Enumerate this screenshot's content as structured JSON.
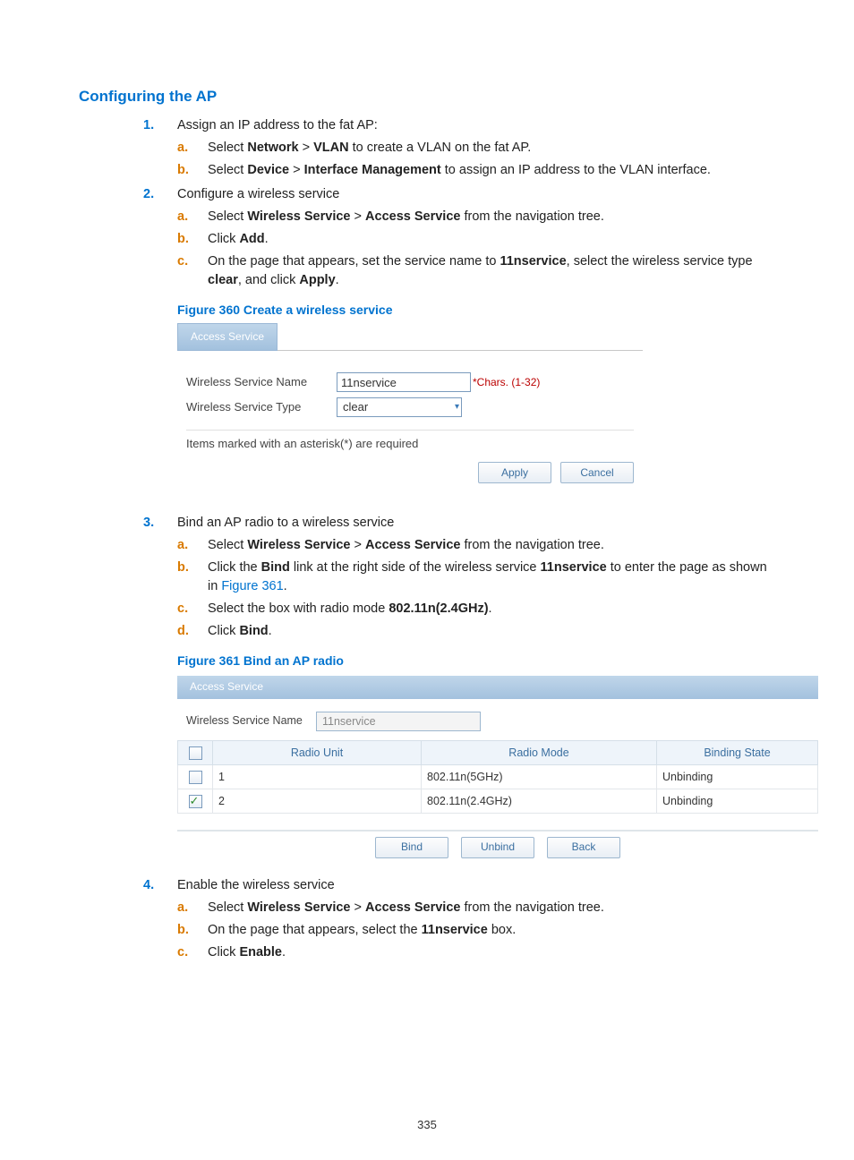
{
  "page_number": "335",
  "section_title": "Configuring the AP",
  "steps": {
    "s1": {
      "marker": "1.",
      "text": "Assign an IP address to the fat AP:",
      "a": {
        "m": "a.",
        "pre": "Select ",
        "b1": "Network",
        "sep": " > ",
        "b2": "VLAN",
        "post": " to create a VLAN on the fat AP."
      },
      "b": {
        "m": "b.",
        "pre": "Select ",
        "b1": "Device",
        "sep": " > ",
        "b2": "Interface Management",
        "post": " to assign an IP address to the VLAN interface."
      }
    },
    "s2": {
      "marker": "2.",
      "text": "Configure a wireless service",
      "a": {
        "m": "a.",
        "pre": "Select ",
        "b1": "Wireless Service",
        "sep": " > ",
        "b2": "Access Service",
        "post": " from the navigation tree."
      },
      "b": {
        "m": "b.",
        "pre": "Click ",
        "b1": "Add",
        "post": "."
      },
      "c": {
        "m": "c.",
        "pre": "On the page that appears, set the service name to ",
        "b1": "11nservice",
        "mid": ", select the wireless service type ",
        "b2": "clear",
        "post": ", and click ",
        "b3": "Apply",
        "post2": "."
      }
    },
    "s3": {
      "marker": "3.",
      "text": "Bind an AP radio to a wireless service",
      "a": {
        "m": "a.",
        "pre": "Select ",
        "b1": "Wireless Service",
        "sep": " > ",
        "b2": "Access Service",
        "post": " from the navigation tree."
      },
      "b": {
        "m": "b.",
        "pre": "Click the ",
        "b1": "Bind",
        "mid": " link at the right side of the wireless service ",
        "b2": "11nservice",
        "post": " to enter the page as shown in ",
        "link": "Figure 361",
        "post2": "."
      },
      "c": {
        "m": "c.",
        "pre": "Select the box with radio mode ",
        "b1": "802.11n(2.4GHz)",
        "post": "."
      },
      "d": {
        "m": "d.",
        "pre": "Click ",
        "b1": "Bind",
        "post": "."
      }
    },
    "s4": {
      "marker": "4.",
      "text": "Enable the wireless service",
      "a": {
        "m": "a.",
        "pre": "Select ",
        "b1": "Wireless Service",
        "sep": " > ",
        "b2": "Access Service",
        "post": " from the navigation tree."
      },
      "b": {
        "m": "b.",
        "pre": "On the page that appears, select the ",
        "b1": "11nservice",
        "post": " box."
      },
      "c": {
        "m": "c.",
        "pre": "Click ",
        "b1": "Enable",
        "post": "."
      }
    }
  },
  "fig360": {
    "caption": "Figure 360 Create a wireless service",
    "tab": "Access Service",
    "name_label": "Wireless Service Name",
    "name_value": "11nservice",
    "name_hint": "*Chars. (1-32)",
    "type_label": "Wireless Service Type",
    "type_value": "clear",
    "note": "Items marked with an asterisk(*) are required",
    "apply": "Apply",
    "cancel": "Cancel"
  },
  "fig361": {
    "caption": "Figure 361 Bind an AP radio",
    "tab": "Access Service",
    "name_label": "Wireless Service Name",
    "name_value": "11nservice",
    "th_ru": "Radio Unit",
    "th_rm": "Radio Mode",
    "th_bs": "Binding State",
    "rows": [
      {
        "checked": false,
        "ru": "1",
        "rm": "802.11n(5GHz)",
        "bs": "Unbinding"
      },
      {
        "checked": true,
        "ru": "2",
        "rm": "802.11n(2.4GHz)",
        "bs": "Unbinding"
      }
    ],
    "bind": "Bind",
    "unbind": "Unbind",
    "back": "Back"
  }
}
